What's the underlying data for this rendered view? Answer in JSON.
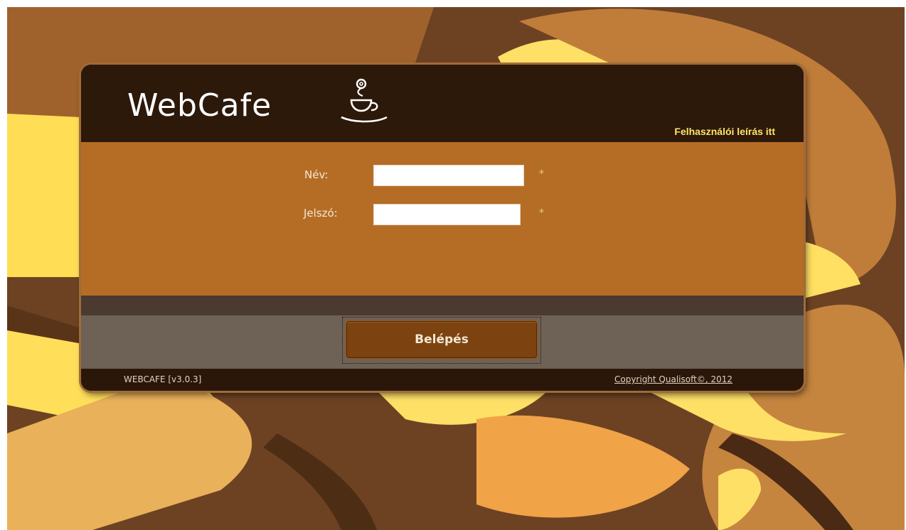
{
  "app": {
    "logo_text": "WebCafe",
    "logo_icon": "coffee-cup-icon"
  },
  "header": {
    "manual_link": "Felhasználói leírás itt"
  },
  "form": {
    "name_label": "Név:",
    "name_value": "",
    "name_required": "*",
    "password_label": "Jelszó:",
    "password_value": "",
    "password_required": "*"
  },
  "actions": {
    "login_label": "Belépés"
  },
  "footer": {
    "version": "WEBCAFE [v3.0.3]",
    "copyright": "Copyright Qualisoft©, 2012"
  },
  "colors": {
    "header_bg": "#2c190a",
    "form_bg": "#b56d26",
    "action_bg": "#6e6155",
    "button_bg": "#7c4310",
    "link_yellow": "#ffe46a"
  }
}
